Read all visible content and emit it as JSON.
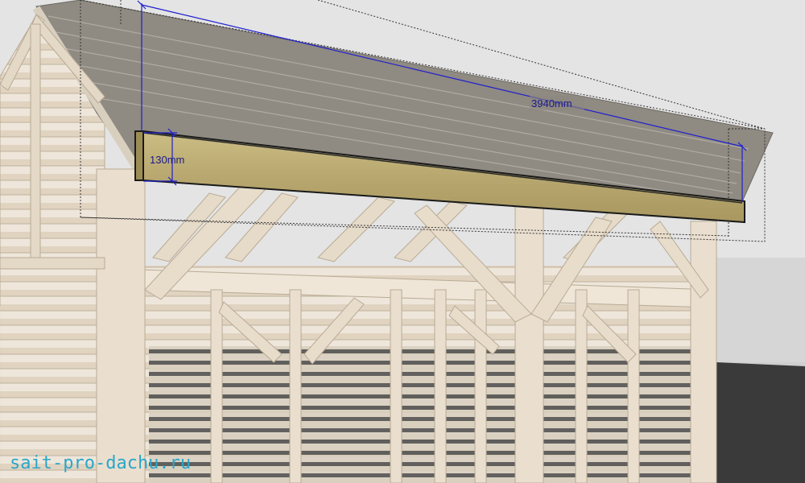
{
  "dimensions": {
    "length_label": "3940mm",
    "height_label": "130mm"
  },
  "watermark": {
    "text": "sait-pro-dachu.ru"
  },
  "colors": {
    "sky": "#e6e6e6",
    "roof": "#8c877f",
    "timber_ghost": "#e8dccb",
    "timber_edge": "#b9ab95",
    "beam": "#b8a870",
    "dimension_line": "#1f1fcf",
    "watermark": "#2aa7c9"
  }
}
